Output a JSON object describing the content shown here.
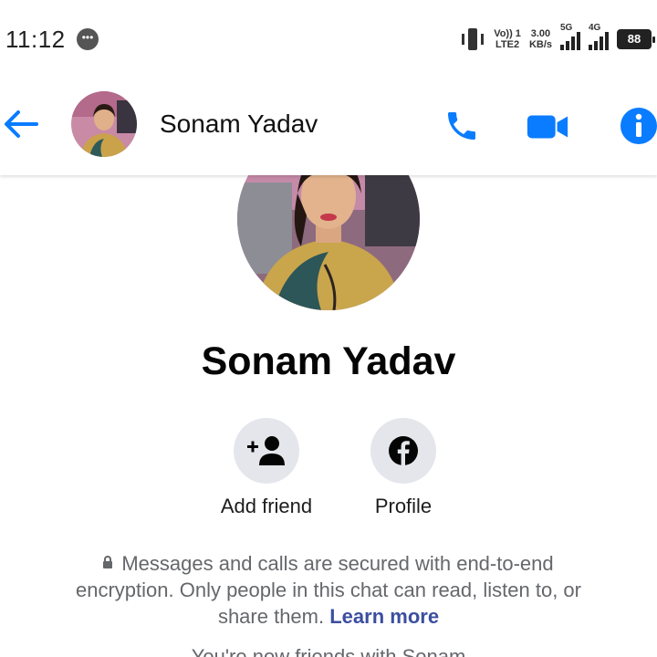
{
  "status_bar": {
    "time": "11:12",
    "volte_top": "Vo)) 1",
    "volte_bottom": "LTE2",
    "speed_value": "3.00",
    "speed_unit": "KB/s",
    "net1": "5G",
    "net2": "4G",
    "battery": "88"
  },
  "header": {
    "contact_name": "Sonam Yadav"
  },
  "profile": {
    "name": "Sonam Yadav"
  },
  "actions": {
    "add_friend_label": "Add friend",
    "profile_label": "Profile"
  },
  "encryption": {
    "text": "Messages and calls are secured with end-to-end encryption. Only people in this chat can read, listen to, or share them.",
    "link": "Learn more"
  },
  "system_message": "You're now friends with Sonam",
  "colors": {
    "accent": "#0a7cff",
    "action_bg": "#e4e6eb",
    "secondary_text": "#65676b",
    "link": "#3b4ea0"
  }
}
